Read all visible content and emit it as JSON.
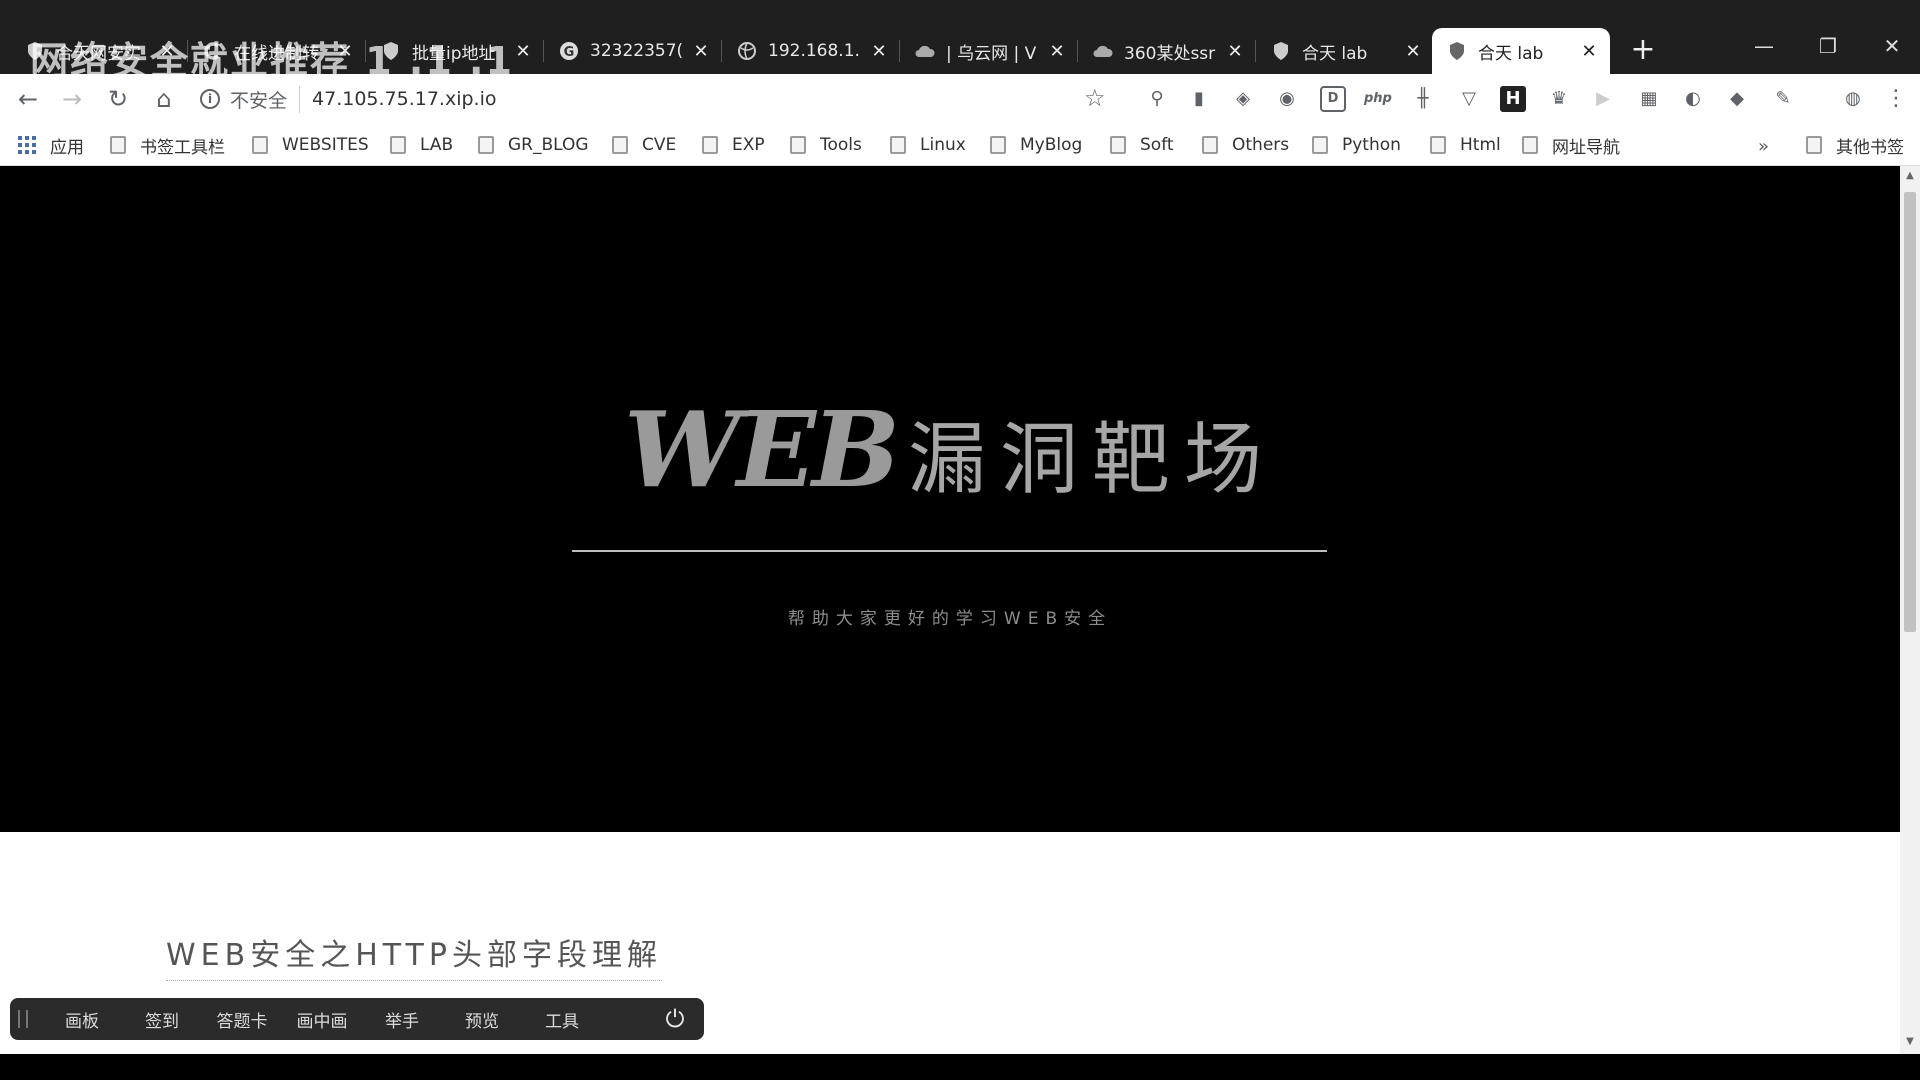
{
  "overlay": {
    "watermark": "网络安全就业推荐 1 .1 .1"
  },
  "tabs": [
    {
      "title": "合天网安实",
      "icon": "shield-icon"
    },
    {
      "title": "在线进制转",
      "icon": "c-logo-icon"
    },
    {
      "title": "批量ip地址",
      "icon": "shield-icon"
    },
    {
      "title": "32322357(",
      "icon": "google-icon"
    },
    {
      "title": "192.168.1.",
      "icon": "globe-icon"
    },
    {
      "title": "| 乌云网 | V",
      "icon": "cloud-icon"
    },
    {
      "title": "360某处ssr",
      "icon": "cloud-icon"
    },
    {
      "title": "合天 lab",
      "icon": "shield-icon"
    },
    {
      "title": "合天 lab",
      "icon": "shield-icon"
    }
  ],
  "active_tab_index": 8,
  "window": {
    "minimize": "—",
    "restore": "❐",
    "close": "✕",
    "new_tab": "+"
  },
  "toolbar": {
    "security_label": "不安全",
    "url": "47.105.75.17.xip.io"
  },
  "bookmarks": {
    "apps_label": "应用",
    "folders": [
      "书签工具栏",
      "WEBSITES",
      "LAB",
      "GR_BLOG",
      "CVE",
      "EXP",
      "Tools",
      "Linux",
      "MyBlog",
      "Soft",
      "Others",
      "Python",
      "Html",
      "网址导航"
    ],
    "more_label": "»",
    "other_label": "其他书签"
  },
  "page": {
    "hero_web": "WEB",
    "hero_cn": "漏洞靶场",
    "hero_subtitle": "帮助大家更好的学习WEB安全",
    "section_title": "WEB安全之HTTP头部字段理解"
  },
  "float_toolbar": {
    "items": [
      "画板",
      "签到",
      "答题卡",
      "画中画",
      "举手",
      "预览",
      "工具"
    ]
  }
}
